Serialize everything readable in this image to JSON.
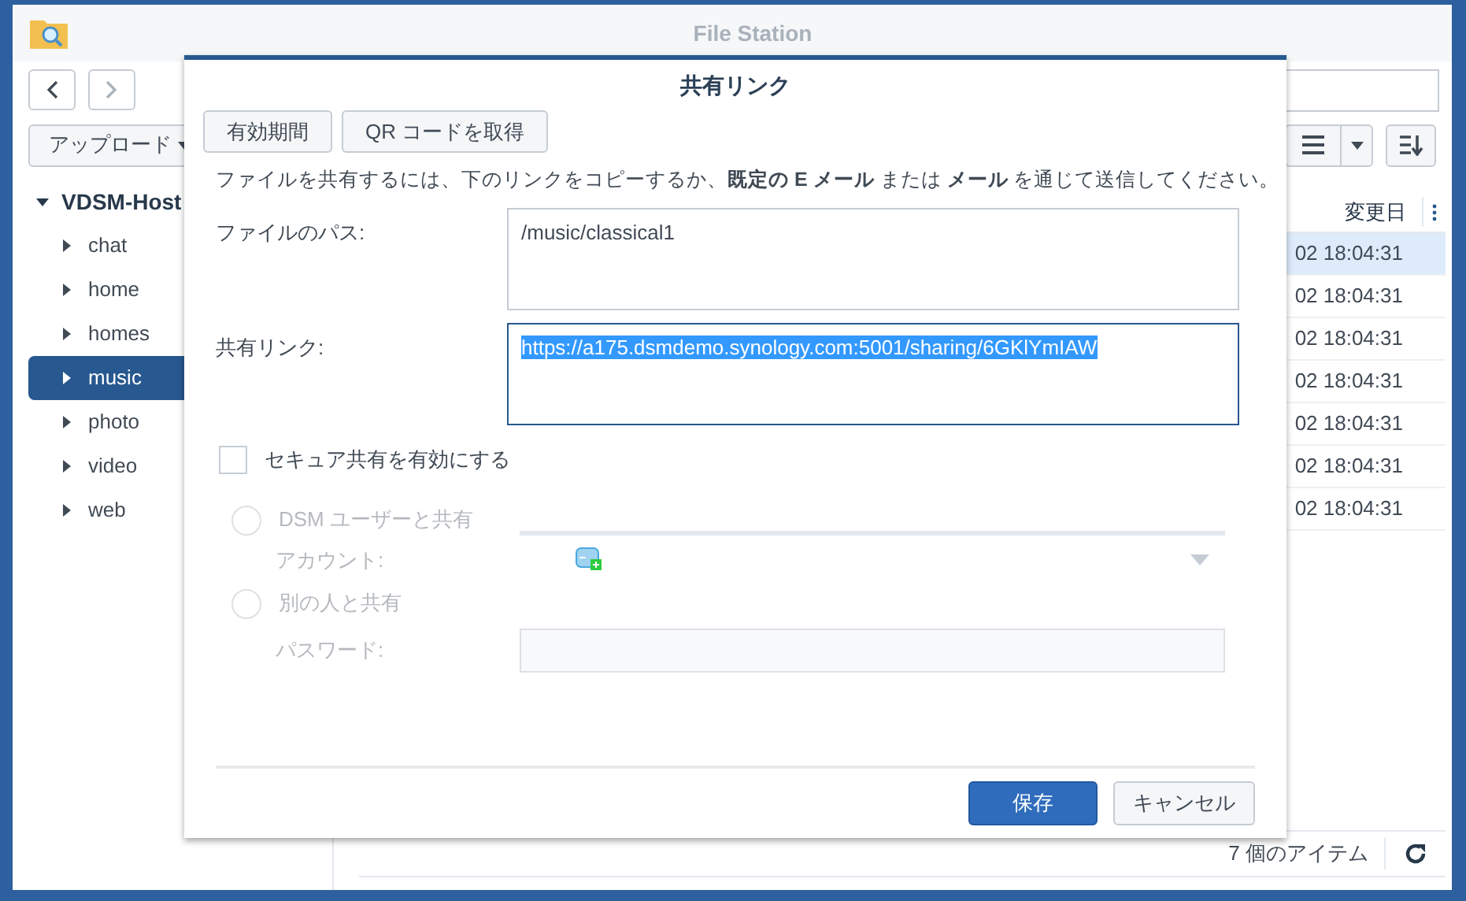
{
  "window": {
    "title": "File Station"
  },
  "toolbar": {
    "upload_button": "アップロード"
  },
  "tree": {
    "label": "VDSM-Host",
    "expanded": true,
    "children": [
      {
        "label": "chat",
        "selected": false
      },
      {
        "label": "home",
        "selected": false
      },
      {
        "label": "homes",
        "selected": false
      },
      {
        "label": "music",
        "selected": true
      },
      {
        "label": "photo",
        "selected": false
      },
      {
        "label": "video",
        "selected": false
      },
      {
        "label": "web",
        "selected": false
      }
    ]
  },
  "file_list": {
    "column": "変更日",
    "rows": [
      {
        "modified": "02 18:04:31",
        "selected": true
      },
      {
        "modified": "02 18:04:31",
        "selected": false
      },
      {
        "modified": "02 18:04:31",
        "selected": false
      },
      {
        "modified": "02 18:04:31",
        "selected": false
      },
      {
        "modified": "02 18:04:31",
        "selected": false
      },
      {
        "modified": "02 18:04:31",
        "selected": false
      },
      {
        "modified": "02 18:04:31",
        "selected": false
      }
    ]
  },
  "status_bar": {
    "count": "7 個のアイテム"
  },
  "dialog": {
    "title": "共有リンク",
    "tabs": [
      "有効期間",
      "QR コードを取得"
    ],
    "instruction": "ファイルを共有するには、下のリンクをコピーするか、**既定の E メール** または **メール** を通じて送信してください。",
    "file_path": {
      "label": "ファイルのパス:",
      "value": "/music/classical1"
    },
    "share_link": {
      "label": "共有リンク:",
      "value": "https://a175.dsmdemo.synology.com:5001/sharing/6GKlYmIAW",
      "highlighted": true
    },
    "secure_share": {
      "label": "セキュア共有を有効にする",
      "checked": false
    },
    "options": [
      {
        "kind": "account",
        "label": "DSM ユーザーと共有",
        "selected": false,
        "field_label": "アカウント:"
      },
      {
        "kind": "password",
        "label": "別の人と共有",
        "selected": false,
        "field_label": "パスワード:"
      }
    ],
    "buttons": [
      {
        "label": "保存",
        "kind": "primary"
      },
      {
        "label": "キャンセル",
        "kind": "secondary"
      }
    ]
  }
}
